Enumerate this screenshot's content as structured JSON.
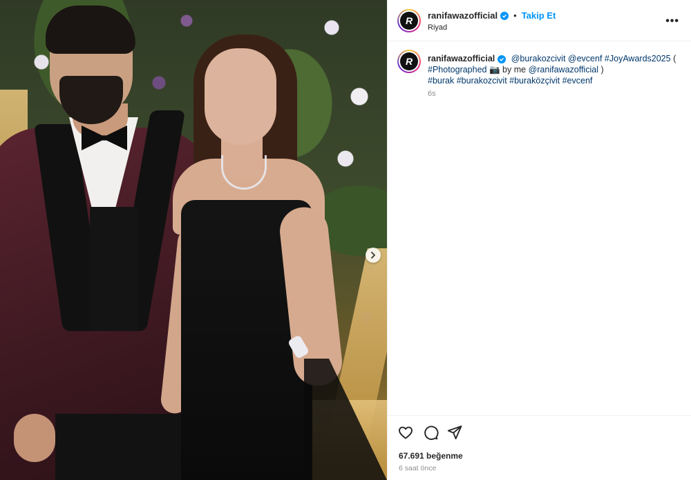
{
  "post": {
    "username": "ranifawazofficial",
    "avatar_letter": "R",
    "follow_label": "Takip Et",
    "separator": "•",
    "location": "Riyad",
    "more_label": "•••"
  },
  "caption": {
    "username": "ranifawazofficial",
    "mention_1": "@burakozcivit",
    "mention_2": "@evcenf",
    "hashtag_1": "#JoyAwards2025",
    "open_paren": "(",
    "hashtag_2": "#Photographed",
    "camera_emoji": "📷",
    "by_me": "by me",
    "mention_3": "@ranifawazofficial",
    "close_paren": ")",
    "hashtag_3": "#burak",
    "hashtag_4": "#burakozcivit",
    "hashtag_5": "#buraközçivit",
    "hashtag_6": "#evcenf",
    "time": "6s"
  },
  "footer": {
    "likes": "67.691 beğenme",
    "time_ago": "6 saat önce"
  },
  "icons": {
    "like": "heart-icon",
    "comment": "comment-icon",
    "share": "share-icon",
    "next": "chevron-right-icon"
  },
  "colors": {
    "accent": "#0095f6",
    "link": "#00376b",
    "muted": "#8e8e8e"
  }
}
